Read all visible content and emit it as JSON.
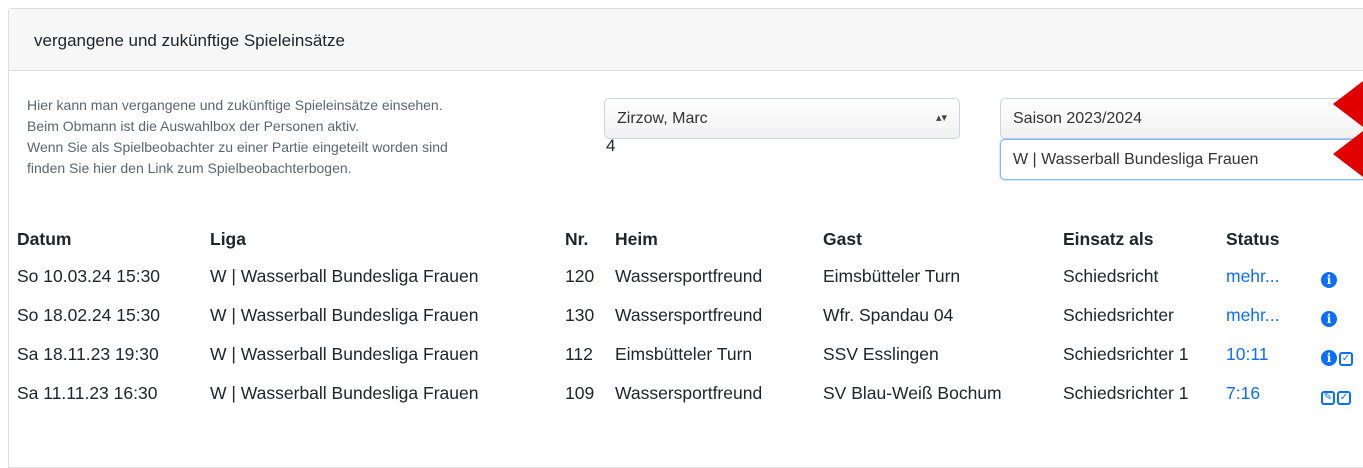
{
  "card": {
    "title": "vergangene und zukünftige Spieleinsätze"
  },
  "info": {
    "lines": [
      "Hier kann man vergangene und zukünftige Spieleinsätze einsehen.",
      "Beim Obmann ist die Auswahlbox der Personen aktiv.",
      "Wenn Sie als Spielbeobachter zu einer Partie eingeteilt worden sind",
      "finden Sie hier den Link zum Spielbeobachterbogen."
    ]
  },
  "filters": {
    "person": "Zirzow, Marc",
    "count": "4",
    "season": "Saison 2023/2024",
    "league": "W | Wasserball Bundesliga Frauen"
  },
  "table": {
    "headers": {
      "datum": "Datum",
      "liga": "Liga",
      "nr": "Nr.",
      "heim": "Heim",
      "gast": "Gast",
      "einsatz": "Einsatz als",
      "status": "Status"
    },
    "rows": [
      {
        "datum": "So 10.03.24 15:30",
        "liga": "W | Wasserball Bundesliga Frauen",
        "nr": "120",
        "heim": "Wassersportfreund",
        "gast": "Eimsbütteler Turn",
        "einsatz": "Schiedsricht",
        "status": "mehr..."
      },
      {
        "datum": "So 18.02.24 15:30",
        "liga": "W | Wasserball Bundesliga Frauen",
        "nr": "130",
        "heim": "Wassersportfreund",
        "gast": "Wfr. Spandau 04",
        "einsatz": "Schiedsrichter",
        "status": "mehr..."
      },
      {
        "datum": "Sa 18.11.23 19:30",
        "liga": "W | Wasserball Bundesliga Frauen",
        "nr": "112",
        "heim": "Eimsbütteler Turn",
        "gast": "SSV Esslingen",
        "einsatz": "Schiedsrichter 1",
        "status": "10:11"
      },
      {
        "datum": "Sa 11.11.23 16:30",
        "liga": "W | Wasserball Bundesliga Frauen",
        "nr": "109",
        "heim": "Wassersportfreund",
        "gast": "SV Blau-Weiß Bochum",
        "einsatz": "Schiedsrichter 1",
        "status": "7:16"
      }
    ]
  },
  "icons": {
    "info": "info-circle-icon",
    "edit": "edit-icon",
    "check": "check-square-icon"
  },
  "colors": {
    "link": "#0d6efd",
    "marker": "#e00000"
  }
}
